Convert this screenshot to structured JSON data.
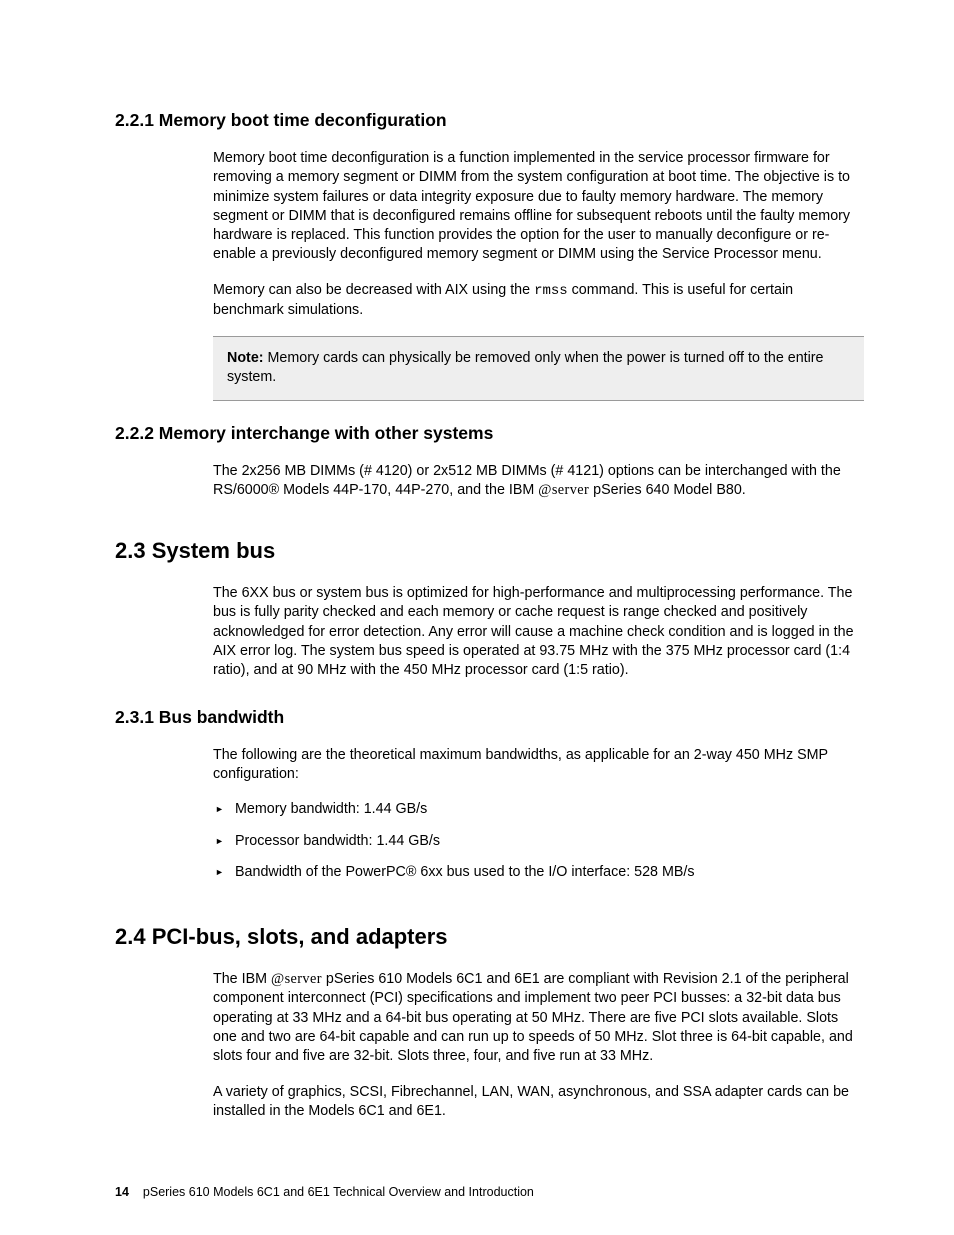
{
  "sections": {
    "s221": {
      "heading": "2.2.1  Memory boot time deconfiguration",
      "p1": "Memory boot time deconfiguration is a function implemented in the service processor firmware for removing a memory segment or DIMM from the system configuration at boot time. The objective is to minimize system failures or data integrity exposure due to faulty memory hardware. The memory segment or DIMM that is deconfigured remains offline for subsequent reboots until the faulty memory hardware is replaced. This function provides the option for the user to manually deconfigure or re-enable a previously deconfigured memory segment or DIMM using the Service Processor menu.",
      "p2_a": "Memory can also be decreased with AIX using the ",
      "p2_cmd": "rmss",
      "p2_b": " command. This is useful for certain benchmark simulations.",
      "note_label": "Note:",
      "note_text": " Memory cards can physically be removed only when the power is turned off to the entire system."
    },
    "s222": {
      "heading": "2.2.2  Memory interchange with other systems",
      "p1_a": "The 2x256 MB DIMMs (# 4120) or 2x512 MB DIMMs (# 4121) options can be interchanged with the RS/6000® Models 44P-170, 44P-270, and the IBM ",
      "p1_eserver": "@server",
      "p1_b": " pSeries 640 Model B80."
    },
    "s23": {
      "heading": "2.3  System bus",
      "p1": "The 6XX bus or system bus is optimized for high-performance and multiprocessing performance. The bus is fully parity checked and each memory or cache request is range checked and positively acknowledged for error detection. Any error will cause a machine check condition and is logged in the AIX error log. The system bus speed is operated at 93.75 MHz with the 375 MHz processor card (1:4 ratio), and at 90 MHz with the 450 MHz processor card (1:5 ratio)."
    },
    "s231": {
      "heading": "2.3.1  Bus bandwidth",
      "p1": "The following are the theoretical maximum bandwidths, as applicable for an 2-way 450 MHz SMP configuration:",
      "items": [
        "Memory bandwidth: 1.44 GB/s",
        "Processor bandwidth: 1.44 GB/s",
        "Bandwidth of the PowerPC® 6xx bus used to the I/O interface: 528 MB/s"
      ]
    },
    "s24": {
      "heading": "2.4  PCI-bus, slots, and adapters",
      "p1_a": "The IBM ",
      "p1_eserver": "@server",
      "p1_b": " pSeries 610 Models 6C1 and 6E1 are compliant with Revision 2.1 of the peripheral component interconnect (PCI) specifications and implement two peer PCI busses: a 32-bit data bus operating at 33 MHz and a 64-bit bus operating at 50 MHz. There are five PCI slots available. Slots one and two are 64-bit capable and can run up to speeds of 50 MHz. Slot three is 64-bit capable, and slots four and five are 32-bit. Slots three, four, and five run at 33 MHz.",
      "p2": "A variety of graphics, SCSI, Fibrechannel, LAN, WAN, asynchronous, and SSA adapter cards can be installed in the Models 6C1 and 6E1."
    }
  },
  "footer": {
    "page": "14",
    "title": "pSeries 610 Models 6C1 and 6E1 Technical Overview and Introduction"
  }
}
